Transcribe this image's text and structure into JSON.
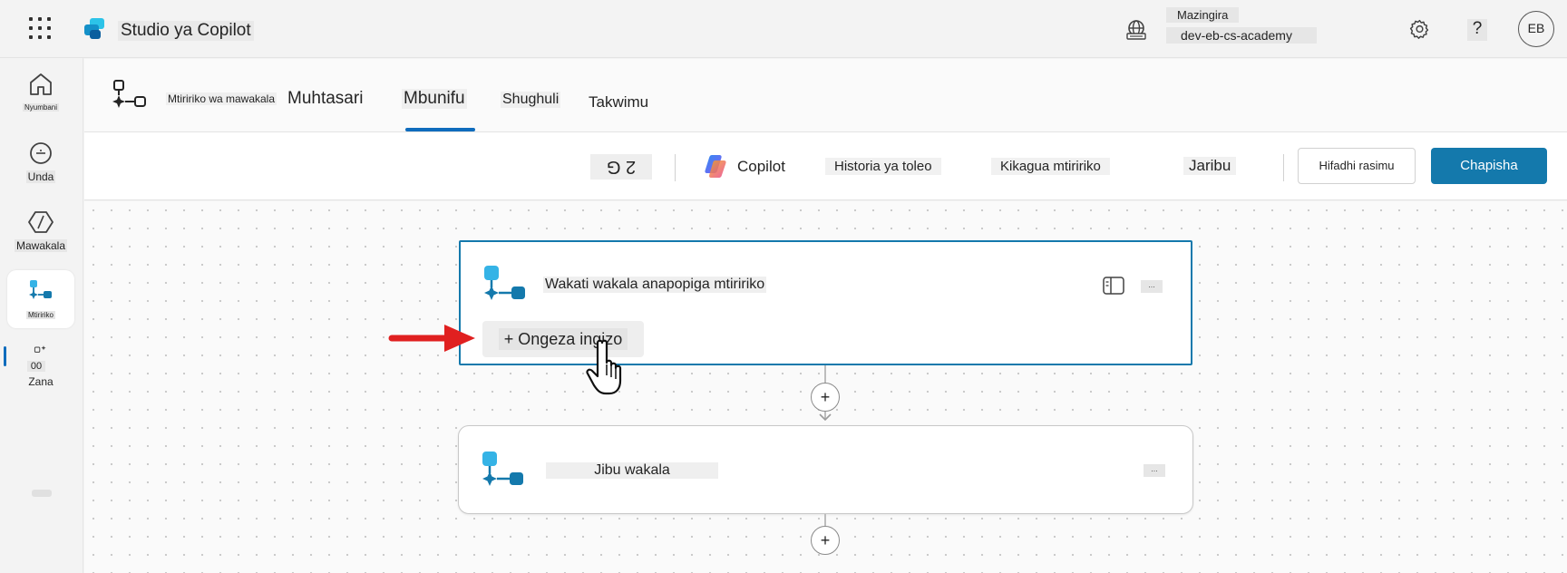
{
  "topbar": {
    "app_title": "Studio ya Copilot",
    "environment_label": "Mazingira",
    "environment_name": "dev-eb-cs-academy",
    "help_label": "?",
    "avatar_initials": "EB"
  },
  "leftnav": {
    "items": [
      {
        "label": "Nyumbani",
        "icon": "home-icon"
      },
      {
        "label": "Unda",
        "icon": "create-icon"
      },
      {
        "label": "Mawakala",
        "icon": "agents-icon"
      },
      {
        "label": "Mtiririko",
        "icon": "flows-icon"
      },
      {
        "label": "Zana",
        "icon": "tools-icon"
      }
    ],
    "tools_badge": "00"
  },
  "pagehead": {
    "breadcrumb": "Mtiririko wa mawakala",
    "tabs": [
      {
        "label": "Muhtasari"
      },
      {
        "label": "Mbunifu",
        "active": true
      },
      {
        "label": "Shughuli"
      },
      {
        "label": "Takwimu"
      }
    ]
  },
  "toolbar": {
    "undo_redo": "2 G",
    "copilot_label": "Copilot",
    "version_history_label": "Historia ya toleo",
    "flow_checker_label": "Kikagua mtiririko",
    "test_label": "Jaribu",
    "save_draft_label": "Hifadhi rasimu",
    "publish_label": "Chapisha"
  },
  "canvas": {
    "trigger_node": {
      "title": "Wakati wakala anapopiga mtiririko",
      "add_input_label": "+ Ongeza ingizo",
      "more_label": "..."
    },
    "respond_node": {
      "title": "Jibu wakala",
      "more_label": "..."
    },
    "add_step_label": "+"
  },
  "colors": {
    "accent": "#1479ac",
    "tab_underline": "#0f6cbd",
    "annotation_arrow": "#e02020"
  }
}
